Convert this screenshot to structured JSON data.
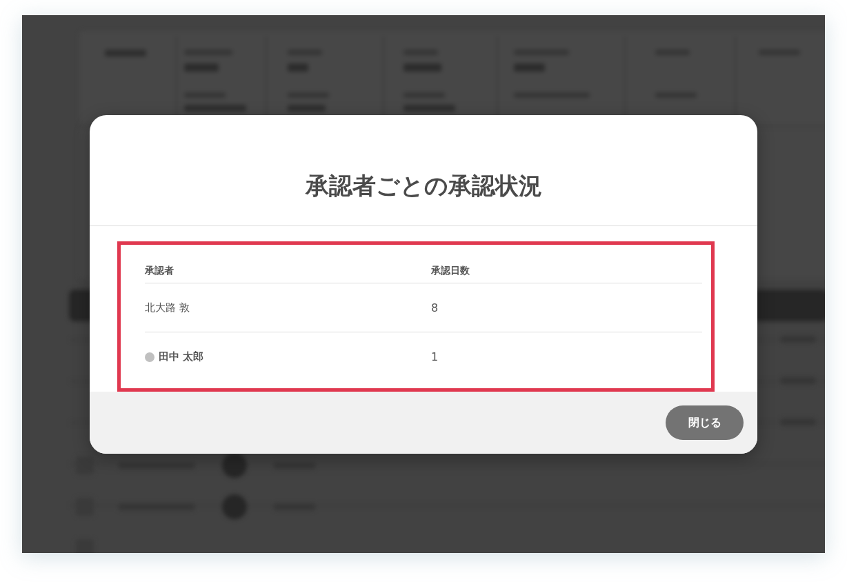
{
  "dialog": {
    "title": "承認者ごとの承認状況",
    "table": {
      "emphasized": true,
      "columns": [
        "承認者",
        "承認日数"
      ],
      "rows": [
        {
          "approver": "北大路 敦",
          "days": "8",
          "highlighted": false
        },
        {
          "approver": "田中 太郎",
          "days": "1",
          "highlighted": true
        }
      ]
    },
    "buttons": [
      {
        "label": "閉じる",
        "kind": "close"
      }
    ]
  }
}
